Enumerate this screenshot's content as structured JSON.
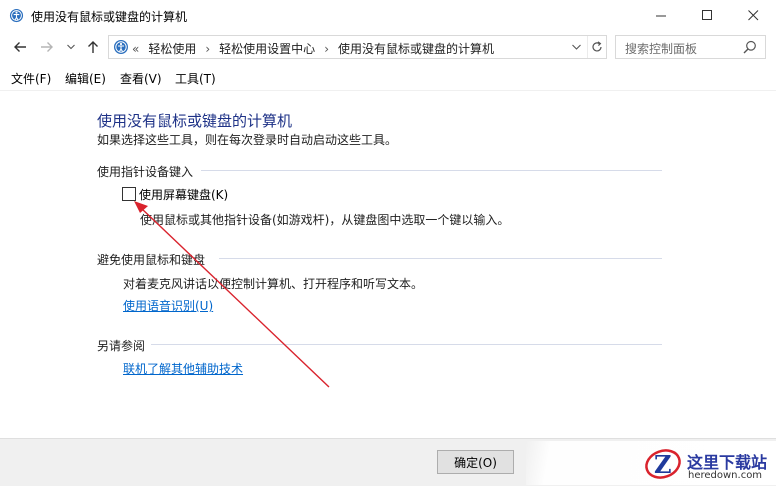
{
  "window": {
    "title": "使用没有鼠标或键盘的计算机"
  },
  "address_bar": {
    "overflow": "«",
    "crumbs": [
      "轻松使用",
      "轻松使用设置中心",
      "使用没有鼠标或键盘的计算机"
    ],
    "separator": "›",
    "search_placeholder": "搜索控制面板"
  },
  "menu": {
    "file": "文件(F)",
    "edit": "编辑(E)",
    "view": "查看(V)",
    "tools": "工具(T)"
  },
  "content": {
    "heading": "使用没有鼠标或键盘的计算机",
    "subtext": "如果选择这些工具，则在每次登录时自动启动这些工具。",
    "pointer_section": {
      "title": "使用指针设备键入",
      "checkbox_label": "使用屏幕键盘(K)",
      "checked": false,
      "description": "使用鼠标或其他指针设备(如游戏杆)，从键盘图中选取一个键以输入。"
    },
    "speech_section": {
      "title": "避免使用鼠标和键盘",
      "description": "对着麦克风讲话以便控制计算机、打开程序和听写文本。",
      "link": "使用语音识别(U)"
    },
    "see_also": {
      "title": "另请参阅",
      "link": "联机了解其他辅助技术"
    }
  },
  "footer": {
    "ok": "确定(O)"
  },
  "watermark": {
    "name": "这里下载站",
    "domain": "heredown.com"
  },
  "colors": {
    "heading": "#1e3287",
    "link": "#0066cc",
    "annotation_arrow": "#d9232d"
  }
}
